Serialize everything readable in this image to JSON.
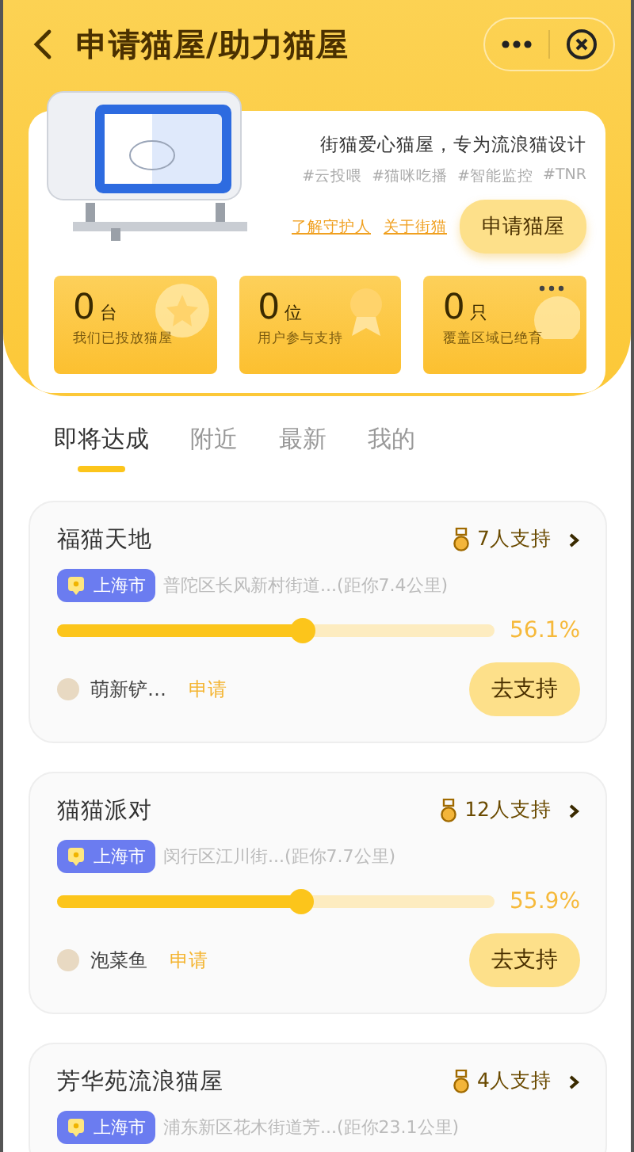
{
  "header": {
    "title": "申请猫屋/助力猫屋"
  },
  "intro": {
    "slogan": "街猫爱心猫屋，专为流浪猫设计",
    "tags": [
      "#云投喂",
      "#猫咪吃播",
      "#智能监控",
      "#TNR"
    ],
    "links": [
      "了解守护人",
      "关于街猫"
    ],
    "apply_button": "申请猫屋"
  },
  "stats": [
    {
      "number": "0",
      "unit": "台",
      "label": "我们已投放猫屋",
      "kind": "star"
    },
    {
      "number": "0",
      "unit": "位",
      "label": "用户参与支持",
      "kind": "badge"
    },
    {
      "number": "0",
      "unit": "只",
      "label": "覆盖区域已绝育",
      "kind": "dots"
    }
  ],
  "tabs": [
    {
      "label": "即将达成",
      "selected": true
    },
    {
      "label": "附近",
      "selected": false
    },
    {
      "label": "最新",
      "selected": false
    },
    {
      "label": "我的",
      "selected": false
    }
  ],
  "houses": [
    {
      "name": "福猫天地",
      "supporters": "7人支持",
      "city": "上海市",
      "address": "普陀区长风新村街道...(距你7.4公里)",
      "level": 0.561,
      "percent": "56.1%",
      "user": "萌新铲…",
      "action": "申请",
      "button": "去支持"
    },
    {
      "name": "猫猫派对",
      "supporters": "12人支持",
      "city": "上海市",
      "address": "闵行区江川街...(距你7.7公里)",
      "level": 0.559,
      "percent": "55.9%",
      "user": "泡菜鱼",
      "action": "申请",
      "button": "去支持"
    },
    {
      "name": "芳华苑流浪猫屋",
      "supporters": "4人支持",
      "city": "上海市",
      "address": "浦东新区花木街道芳...(距你23.1公里)"
    }
  ]
}
